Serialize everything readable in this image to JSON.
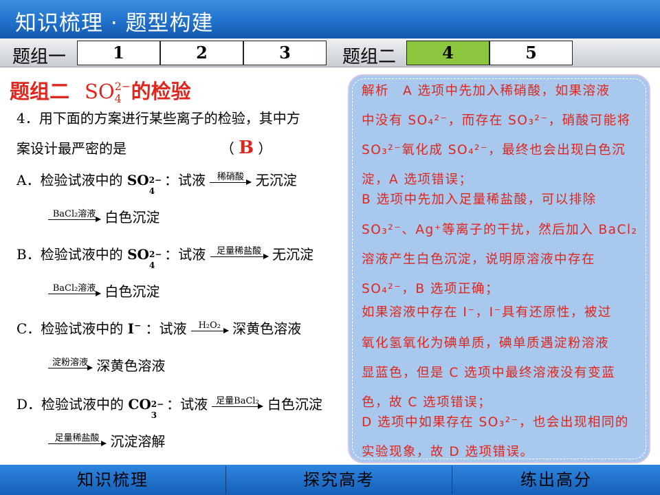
{
  "header": {
    "title": "知识梳理 · 题型构建"
  },
  "tabs": {
    "group1_label": "题组一",
    "group2_label": "题组二",
    "items": [
      {
        "label": "1"
      },
      {
        "label": "2"
      },
      {
        "label": "3"
      },
      {
        "label": "4"
      },
      {
        "label": "5"
      }
    ],
    "active_index": 3,
    "active_color": "#8cc63f"
  },
  "section": {
    "title_prefix": "题组二",
    "title_ion": "SO",
    "title_sub": "4",
    "title_sup": "2−",
    "title_suffix": "的检验"
  },
  "question": {
    "line1": "4．用下面的方案进行某些离子的检验，其中方",
    "line2": "案设计最严密的是",
    "answer_open": "（",
    "answer": "B",
    "answer_close": "）",
    "options": {
      "A": {
        "prefix": "A．检验试液中的",
        "ion": "SO",
        "sub": "4",
        "sup": "2−",
        "mid": "：试液",
        "arrow1": "稀硝酸",
        "result1": "无沉淀",
        "arrow2": "BaCl₂溶液",
        "result2": "白色沉淀"
      },
      "B": {
        "prefix": "B．检验试液中的",
        "ion": "SO",
        "sub": "4",
        "sup": "2−",
        "mid": "：试液",
        "arrow1": "足量稀盐酸",
        "result1": "无沉淀",
        "arrow2": "BaCl₂溶液",
        "result2": "白色沉淀"
      },
      "C": {
        "prefix": "C．检验试液中的",
        "ion": "I",
        "sup": "−",
        "mid": "：试液",
        "arrow1": "H₂O₂",
        "result1": "深黄色溶液",
        "arrow2": "淀粉溶液",
        "result2": "深黄色溶液"
      },
      "D": {
        "prefix": "D．检验试液中的",
        "ion": "CO",
        "sub": "3",
        "sup": "2−",
        "mid": "：试液",
        "arrow1": "足量BaCl₂",
        "result1": "白色沉淀",
        "arrow2": "足量稀盐酸",
        "result2": "沉淀溶解"
      }
    }
  },
  "analysis": {
    "lines": [
      "解析　A 选项中先加入稀硝酸，如果溶液",
      "中没有 SO₄²⁻，而存在 SO₃²⁻，硝酸可能将",
      "SO₃²⁻氧化成 SO₄²⁻，最终也会出现白色沉",
      "淀，A 选项错误；",
      "B 选项中先加入足量稀盐酸，可以排除",
      "SO₃²⁻、Ag⁺等离子的干扰，然后加入 BaCl₂",
      "溶液产生白色沉淀，说明原溶液中存在",
      "SO₄²⁻，B 选项正确；",
      "如果溶液中存在 I⁻，I⁻具有还原性，被过",
      "氧化氢氧化为碘单质，碘单质遇淀粉溶液",
      "显蓝色，但是 C 选项中最终溶液没有变蓝",
      "色，故 C 选项错误；",
      "D 选项中如果存在 SO₃²⁻，也会出现相同的",
      "实验现象，故 D 选项错误。"
    ]
  },
  "footer": {
    "nav": [
      {
        "label": "知识梳理"
      },
      {
        "label": "探究高考"
      },
      {
        "label": "练出高分"
      }
    ]
  }
}
